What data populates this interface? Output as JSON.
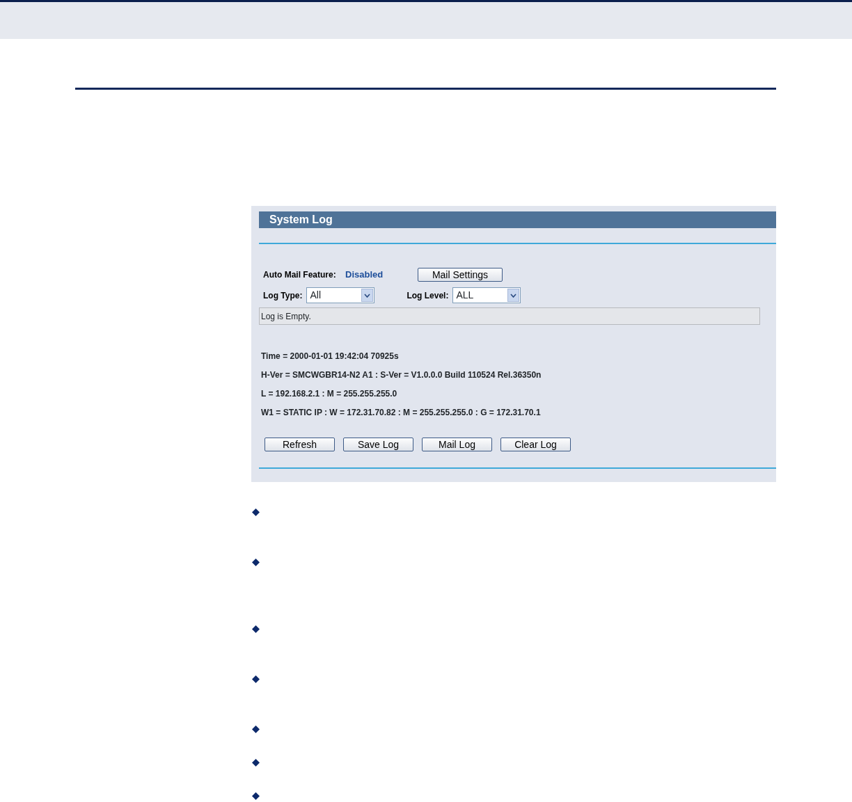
{
  "panel": {
    "title": "System Log",
    "auto_mail": {
      "label": "Auto Mail Feature:",
      "value": "Disabled",
      "button": "Mail Settings"
    },
    "filters": [
      {
        "label": "Log Type:",
        "value": "All"
      },
      {
        "label": "Log Level:",
        "value": "ALL"
      }
    ],
    "log_text": "Log is Empty.",
    "info_lines": [
      "Time = 2000-01-01 19:42:04 70925s",
      "H-Ver = SMCWGBR14-N2 A1 : S-Ver = V1.0.0.0 Build 110524 Rel.36350n",
      "L = 192.168.2.1 : M = 255.255.255.0",
      "W1 = STATIC IP : W = 172.31.70.82 : M = 255.255.255.0 : G = 172.31.70.1"
    ],
    "buttons": [
      "Refresh",
      "Save Log",
      "Mail Log",
      "Clear Log"
    ]
  },
  "bullets": [
    {
      "kind": "diamond"
    },
    {
      "kind": "diamond"
    },
    {
      "kind": "diamond"
    },
    {
      "kind": "diamond"
    },
    {
      "kind": "diamond"
    },
    {
      "kind": "diamond"
    },
    {
      "kind": "diamond"
    }
  ]
}
